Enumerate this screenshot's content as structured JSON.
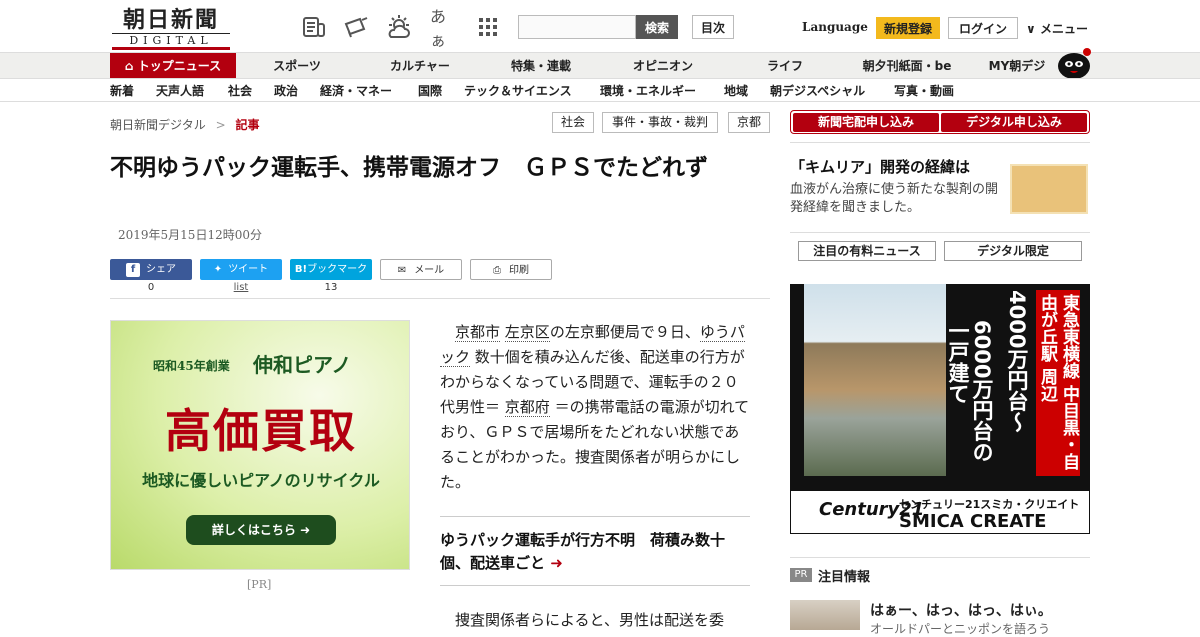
{
  "header": {
    "logo_top": "朝日新聞",
    "logo_bottom": "DIGITAL",
    "search_placeholder": "",
    "search_button": "検索",
    "index_button": "目次",
    "language": "Language",
    "register": "新規登録",
    "login": "ログイン",
    "menu": "メニュー",
    "font_size_glyph": "あぁ"
  },
  "nav_primary": [
    "トップニュース",
    "スポーツ",
    "カルチャー",
    "特集・連載",
    "オピニオン",
    "ライフ",
    "朝夕刊紙面・be",
    "MY朝デジ"
  ],
  "nav_secondary": [
    "新着",
    "天声人語",
    "社会",
    "政治",
    "経済・マネー",
    "国際",
    "テック＆サイエンス",
    "環境・エネルギー",
    "地域",
    "朝デジスペシャル",
    "写真・動画"
  ],
  "breadcrumb": {
    "home": "朝日新聞デジタル",
    "sep": ">",
    "current": "記事"
  },
  "tags": [
    "社会",
    "事件・事故・裁判",
    "京都"
  ],
  "article": {
    "title": "不明ゆうパック運転手、携帯電源オフ　ＧＰＳでたどれず",
    "date": "2019年5月15日12時00分",
    "share": [
      {
        "label": "シェア",
        "count": "0"
      },
      {
        "label": "ツイート",
        "count": "list"
      },
      {
        "label": "ブックマーク",
        "count": "13"
      },
      {
        "label": "メール",
        "count": ""
      },
      {
        "label": "印刷",
        "count": ""
      }
    ],
    "p1_kw1": "京都市",
    "p1_kw2": "左京区",
    "p1_t1": "の左京郵便局で９日、",
    "p1_kw3": "ゆうパック",
    "p1_t2": "数十個を積み込んだ後、配送車の行方がわからなくなっている問題で、運転手の２０代男性＝",
    "p1_kw4": "京都府",
    "p1_t3": "＝の携帯電話の電源が切れており、ＧＰＳで居場所をたどれない状態であることがわかった。捜査関係者が明らかにした。",
    "related": "ゆうパック運転手が行方不明　荷積み数十個、配送車ごと",
    "p2": "捜査関係者らによると、男性は配送を委"
  },
  "ad": {
    "founded": "昭和45年創業",
    "company": "伸和ピアノ",
    "headline": "高価買取",
    "sub": "地球に優しいピアノのリサイクル",
    "button": "詳しくはこちら",
    "pr": "[PR]"
  },
  "sidebar": {
    "apply_home": "新聞宅配申し込み",
    "apply_digital": "デジタル申し込み",
    "promo_title": "「キムリア」開発の経緯は",
    "promo_desc": "血液がん治療に使う新たな製剤の開発経緯を聞きました。",
    "tab_paid": "注目の有料ニュース",
    "tab_digital": "デジタル限定",
    "banner": {
      "red_text": "東急東横線 中目黒・自由が丘駅 周辺",
      "price1": "4000万円台〜",
      "price2": "6000万円台の 一戸建て",
      "brand1": "Century21",
      "brand2": "センチュリー21スミカ・クリエイト",
      "brand3": "SMICA CREATE"
    },
    "pr_badge": "PR",
    "pr_heading": "注目情報",
    "pr_item_title": "はぁー、はっ、はっ、はぃ。",
    "pr_item_desc": "オールドパーとニッポンを語ろう"
  },
  "colors": {
    "brand_red": "#b3000f",
    "register_yellow": "#f3b91d",
    "facebook": "#3b5998",
    "twitter": "#1da1f2",
    "hatena": "#00a4de"
  }
}
